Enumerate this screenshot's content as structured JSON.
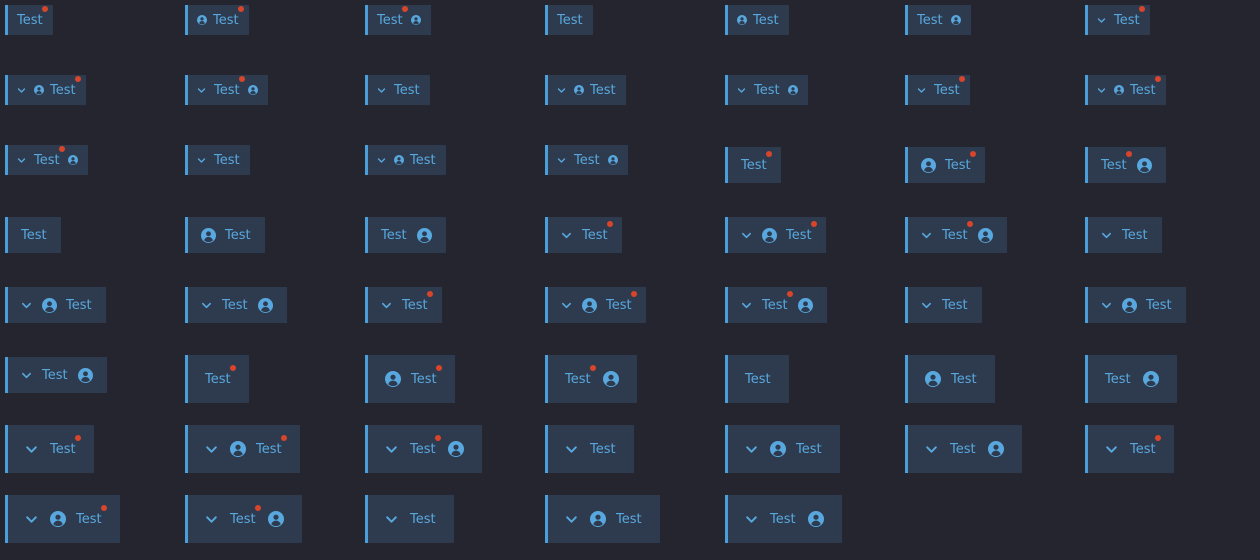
{
  "colors": {
    "background": "#252530",
    "chip_bg": "#2e3b4e",
    "accent": "#4a9fd8",
    "text": "#58a8df",
    "dot": "#d9452b"
  },
  "icons": {
    "chevron": "chevron-down-icon",
    "user": "user-circle-icon"
  },
  "chips": [
    {
      "label": "Test",
      "size": "s",
      "chevron": false,
      "icon": "none",
      "dot": true
    },
    {
      "label": "Test",
      "size": "s",
      "chevron": false,
      "icon": "lead",
      "dot": true
    },
    {
      "label": "Test",
      "size": "s",
      "chevron": false,
      "icon": "trail",
      "dot": true
    },
    {
      "label": "Test",
      "size": "s",
      "chevron": false,
      "icon": "none",
      "dot": false
    },
    {
      "label": "Test",
      "size": "s",
      "chevron": false,
      "icon": "lead",
      "dot": false
    },
    {
      "label": "Test",
      "size": "s",
      "chevron": false,
      "icon": "trail",
      "dot": false
    },
    {
      "label": "Test",
      "size": "s",
      "chevron": true,
      "icon": "none",
      "dot": true
    },
    {
      "label": "Test",
      "size": "s",
      "chevron": true,
      "icon": "lead",
      "dot": true
    },
    {
      "label": "Test",
      "size": "s",
      "chevron": true,
      "icon": "trail",
      "dot": true
    },
    {
      "label": "Test",
      "size": "s",
      "chevron": true,
      "icon": "none",
      "dot": false
    },
    {
      "label": "Test",
      "size": "s",
      "chevron": true,
      "icon": "lead",
      "dot": false
    },
    {
      "label": "Test",
      "size": "s",
      "chevron": true,
      "icon": "trail",
      "dot": false
    },
    {
      "label": "Test",
      "size": "s",
      "chevron": true,
      "icon": "none",
      "dot": true
    },
    {
      "label": "Test",
      "size": "s",
      "chevron": true,
      "icon": "lead",
      "dot": true
    },
    {
      "label": "Test",
      "size": "s",
      "chevron": true,
      "icon": "trail",
      "dot": true
    },
    {
      "label": "Test",
      "size": "s",
      "chevron": true,
      "icon": "none",
      "dot": false
    },
    {
      "label": "Test",
      "size": "s",
      "chevron": true,
      "icon": "lead",
      "dot": false
    },
    {
      "label": "Test",
      "size": "s",
      "chevron": true,
      "icon": "trail",
      "dot": false
    },
    {
      "label": "Test",
      "size": "m",
      "chevron": false,
      "icon": "none",
      "dot": true
    },
    {
      "label": "Test",
      "size": "m",
      "chevron": false,
      "icon": "lead",
      "dot": true
    },
    {
      "label": "Test",
      "size": "m",
      "chevron": false,
      "icon": "trail",
      "dot": true
    },
    {
      "label": "Test",
      "size": "m",
      "chevron": false,
      "icon": "none",
      "dot": false
    },
    {
      "label": "Test",
      "size": "m",
      "chevron": false,
      "icon": "lead",
      "dot": false
    },
    {
      "label": "Test",
      "size": "m",
      "chevron": false,
      "icon": "trail",
      "dot": false
    },
    {
      "label": "Test",
      "size": "m",
      "chevron": true,
      "icon": "none",
      "dot": true
    },
    {
      "label": "Test",
      "size": "m",
      "chevron": true,
      "icon": "lead",
      "dot": true
    },
    {
      "label": "Test",
      "size": "m",
      "chevron": true,
      "icon": "trail",
      "dot": true
    },
    {
      "label": "Test",
      "size": "m",
      "chevron": true,
      "icon": "none",
      "dot": false
    },
    {
      "label": "Test",
      "size": "m",
      "chevron": true,
      "icon": "lead",
      "dot": false
    },
    {
      "label": "Test",
      "size": "m",
      "chevron": true,
      "icon": "trail",
      "dot": false
    },
    {
      "label": "Test",
      "size": "m",
      "chevron": true,
      "icon": "none",
      "dot": true
    },
    {
      "label": "Test",
      "size": "m",
      "chevron": true,
      "icon": "lead",
      "dot": true
    },
    {
      "label": "Test",
      "size": "m",
      "chevron": true,
      "icon": "trail",
      "dot": true
    },
    {
      "label": "Test",
      "size": "m",
      "chevron": true,
      "icon": "none",
      "dot": false
    },
    {
      "label": "Test",
      "size": "m",
      "chevron": true,
      "icon": "lead",
      "dot": false
    },
    {
      "label": "Test",
      "size": "m",
      "chevron": true,
      "icon": "trail",
      "dot": false
    },
    {
      "label": "Test",
      "size": "l",
      "chevron": false,
      "icon": "none",
      "dot": true
    },
    {
      "label": "Test",
      "size": "l",
      "chevron": false,
      "icon": "lead",
      "dot": true
    },
    {
      "label": "Test",
      "size": "l",
      "chevron": false,
      "icon": "trail",
      "dot": true
    },
    {
      "label": "Test",
      "size": "l",
      "chevron": false,
      "icon": "none",
      "dot": false
    },
    {
      "label": "Test",
      "size": "l",
      "chevron": false,
      "icon": "lead",
      "dot": false
    },
    {
      "label": "Test",
      "size": "l",
      "chevron": false,
      "icon": "trail",
      "dot": false
    },
    {
      "label": "Test",
      "size": "l",
      "chevron": true,
      "icon": "none",
      "dot": true
    },
    {
      "label": "Test",
      "size": "l",
      "chevron": true,
      "icon": "lead",
      "dot": true
    },
    {
      "label": "Test",
      "size": "l",
      "chevron": true,
      "icon": "trail",
      "dot": true
    },
    {
      "label": "Test",
      "size": "l",
      "chevron": true,
      "icon": "none",
      "dot": false
    },
    {
      "label": "Test",
      "size": "l",
      "chevron": true,
      "icon": "lead",
      "dot": false
    },
    {
      "label": "Test",
      "size": "l",
      "chevron": true,
      "icon": "trail",
      "dot": false
    },
    {
      "label": "Test",
      "size": "l",
      "chevron": true,
      "icon": "none",
      "dot": true
    },
    {
      "label": "Test",
      "size": "l",
      "chevron": true,
      "icon": "lead",
      "dot": true
    },
    {
      "label": "Test",
      "size": "l",
      "chevron": true,
      "icon": "trail",
      "dot": true
    },
    {
      "label": "Test",
      "size": "l",
      "chevron": true,
      "icon": "none",
      "dot": false
    },
    {
      "label": "Test",
      "size": "l",
      "chevron": true,
      "icon": "lead",
      "dot": false
    },
    {
      "label": "Test",
      "size": "l",
      "chevron": true,
      "icon": "trail",
      "dot": false
    }
  ]
}
